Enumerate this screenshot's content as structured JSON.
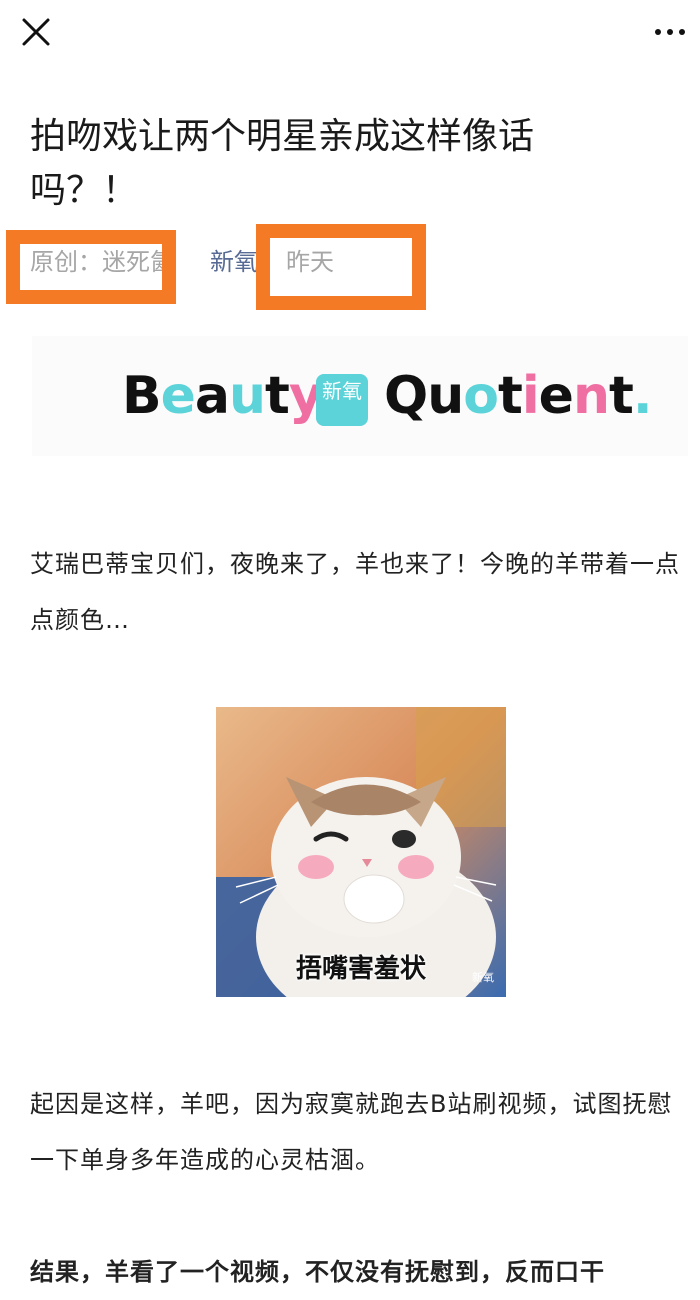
{
  "article": {
    "title": "拍吻戏让两个明星亲成这样像话吗？！",
    "meta": {
      "author_label": "原创：迷死氤",
      "account": "新氧",
      "date": "昨天"
    },
    "banner": {
      "left_word": "Beauty",
      "logo_text": "新氧",
      "right_word": "Quotient."
    },
    "paragraphs": [
      "艾瑞巴蒂宝贝们，夜晚来了，羊也来了！今晚的羊带着一点点颜色…",
      "起因是这样，羊吧，因为寂寞就跑去B站刷视频，试图抚慰一下单身多年造成的心灵枯涸。",
      "结果，羊看了一个视频，不仅没有抚慰到，反而口干"
    ],
    "image": {
      "caption": "捂嘴害羞状",
      "watermark": "新氧"
    }
  },
  "colors": {
    "highlight": "#f47a26",
    "link": "#576b95",
    "meta": "#a6a6a6"
  },
  "icons": {
    "close": "close-icon",
    "more": "more-icon"
  }
}
